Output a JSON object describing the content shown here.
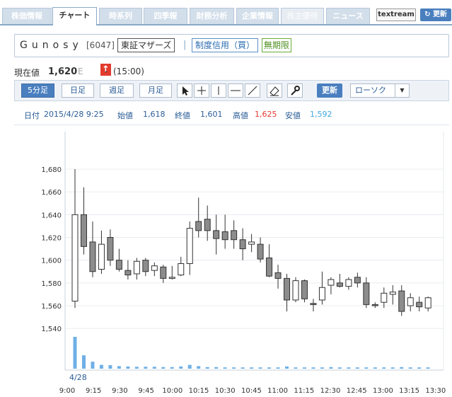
{
  "tabs": [
    {
      "label": "株価情報",
      "state": "normal"
    },
    {
      "label": "チャート",
      "state": "active"
    },
    {
      "label": "時系列",
      "state": "normal"
    },
    {
      "label": "四季報",
      "state": "normal"
    },
    {
      "label": "財務分析",
      "state": "normal"
    },
    {
      "label": "企業情報",
      "state": "normal"
    },
    {
      "label": "株主優待",
      "state": "disabled"
    },
    {
      "label": "ニュース",
      "state": "normal"
    }
  ],
  "header_links": {
    "textream": "textream",
    "refresh": "更新"
  },
  "stock": {
    "name": "Gunosy",
    "code": "[6047]",
    "market": "東証マザーズ",
    "credit": "制度信用（買）",
    "nolimit": "無期限"
  },
  "price": {
    "label": "現在値",
    "value": "1,620",
    "flag": "E",
    "arrow": "↑",
    "change": "-",
    "time": "(15:00)"
  },
  "toolbar": {
    "periods": [
      "5分足",
      "日足",
      "週足",
      "月足"
    ],
    "active_period": 0,
    "update": "更新",
    "chart_type": "ローソク",
    "dropdown": "▼"
  },
  "info": {
    "date_label": "日付",
    "date": "2015/4/28 9:25",
    "open_label": "始値",
    "open": "1,618",
    "close_label": "終値",
    "close": "1,601",
    "high_label": "高値",
    "high": "1,625",
    "low_label": "安値",
    "low": "1,592"
  },
  "colors": {
    "high": "#e23b2e",
    "low": "#3fa9e0",
    "accent": "#4a7fbf"
  },
  "chart_data": {
    "type": "candlestick",
    "date_label": "4/28",
    "ylim": [
      1530,
      1685
    ],
    "y_ticks": [
      1540,
      1560,
      1580,
      1600,
      1620,
      1640,
      1660,
      1680
    ],
    "x_tick_labels": [
      "9:00",
      "9:15",
      "9:30",
      "9:45",
      "10:00",
      "10:15",
      "10:30",
      "10:45",
      "11:00",
      "11:15",
      "12:30",
      "12:45",
      "13:00",
      "13:15",
      "13:30"
    ],
    "candles": [
      [
        1564,
        1680,
        1558,
        1640
      ],
      [
        1640,
        1664,
        1605,
        1612
      ],
      [
        1616,
        1634,
        1585,
        1590
      ],
      [
        1592,
        1626,
        1588,
        1614
      ],
      [
        1620,
        1627,
        1595,
        1600
      ],
      [
        1600,
        1610,
        1590,
        1592
      ],
      [
        1591,
        1600,
        1583,
        1587
      ],
      [
        1588,
        1602,
        1583,
        1599
      ],
      [
        1600,
        1602,
        1586,
        1590
      ],
      [
        1591,
        1598,
        1586,
        1595
      ],
      [
        1594,
        1596,
        1580,
        1584
      ],
      [
        1584,
        1595,
        1583,
        1585
      ],
      [
        1587,
        1603,
        1586,
        1597
      ],
      [
        1597,
        1634,
        1587,
        1628
      ],
      [
        1634,
        1655,
        1620,
        1626
      ],
      [
        1636,
        1648,
        1617,
        1626
      ],
      [
        1626,
        1640,
        1605,
        1619
      ],
      [
        1625,
        1640,
        1610,
        1618
      ],
      [
        1626,
        1635,
        1610,
        1618
      ],
      [
        1618,
        1628,
        1600,
        1610
      ],
      [
        1614,
        1623,
        1607,
        1616
      ],
      [
        1614,
        1620,
        1598,
        1601
      ],
      [
        1602,
        1614,
        1585,
        1586
      ],
      [
        1589,
        1596,
        1575,
        1584
      ],
      [
        1584,
        1588,
        1555,
        1565
      ],
      [
        1565,
        1585,
        1563,
        1582
      ],
      [
        1582,
        1583,
        1563,
        1566
      ],
      [
        1562,
        1566,
        1555,
        1561
      ],
      [
        1565,
        1590,
        1561,
        1576
      ],
      [
        1578,
        1585,
        1570,
        1583
      ],
      [
        1580,
        1588,
        1576,
        1577
      ],
      [
        1577,
        1585,
        1574,
        1583
      ],
      [
        1585,
        1589,
        1576,
        1580
      ],
      [
        1580,
        1585,
        1558,
        1561
      ],
      [
        1561,
        1563,
        1558,
        1560
      ],
      [
        1563,
        1576,
        1558,
        1571
      ],
      [
        1570,
        1578,
        1561,
        1572
      ],
      [
        1573,
        1578,
        1551,
        1555
      ],
      [
        1560,
        1571,
        1555,
        1567
      ],
      [
        1563,
        1568,
        1555,
        1559
      ],
      [
        1558,
        1568,
        1555,
        1567
      ]
    ],
    "volume": [
      100,
      42,
      22,
      12,
      11,
      8,
      7,
      6,
      6,
      6,
      5,
      5,
      7,
      12,
      8,
      5,
      5,
      4,
      4,
      4,
      4,
      4,
      4,
      4,
      7,
      4,
      4,
      4,
      4,
      5,
      4,
      4,
      4,
      4,
      4,
      4,
      4,
      5,
      4,
      4,
      4
    ]
  }
}
